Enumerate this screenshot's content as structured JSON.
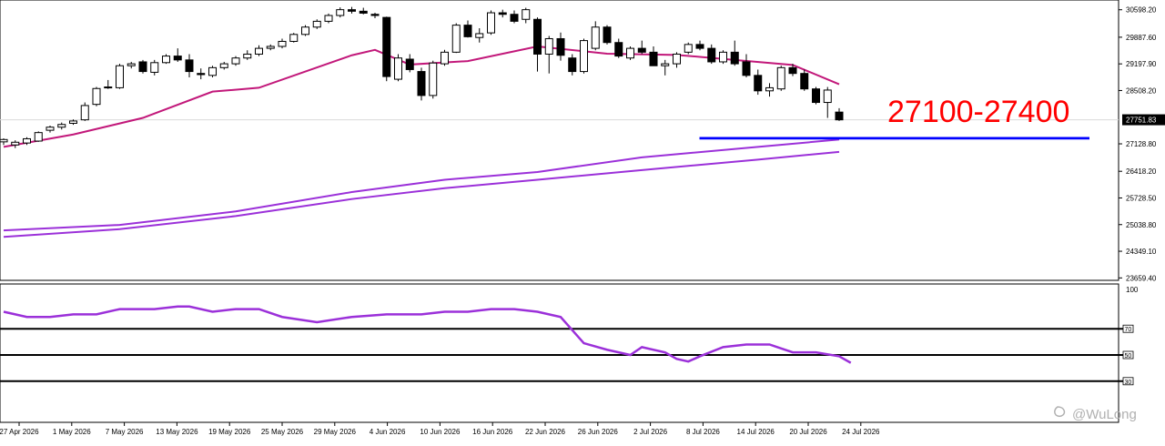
{
  "chart_data": [
    {
      "type": "candlestick",
      "title": "",
      "price_axis": {
        "ticks": [
          "30598.20",
          "29887.60",
          "29197.90",
          "28508.20",
          "27128.80",
          "26418.20",
          "25728.50",
          "25038.80",
          "24349.10",
          "23659.40"
        ],
        "range": [
          23620,
          30780
        ],
        "last_price_label": "27751.83"
      },
      "date_axis": {
        "ticks": [
          "27 Apr 2026",
          "1 May 2026",
          "7 May 2026",
          "13 May 2026",
          "19 May 2026",
          "25 May 2026",
          "29 May 2026",
          "4 Jun 2026",
          "10 Jun 2026",
          "16 Jun 2026",
          "22 Jun 2026",
          "26 Jun 2026",
          "2 Jul 2026",
          "8 Jul 2026",
          "14 Jul 2026",
          "20 Jul 2026",
          "24 Jul 2026"
        ]
      },
      "candles": [
        [
          27180,
          27270,
          27100,
          27240
        ],
        [
          27100,
          27220,
          27020,
          27170
        ],
        [
          27150,
          27300,
          27100,
          27260
        ],
        [
          27200,
          27450,
          27180,
          27420
        ],
        [
          27480,
          27600,
          27420,
          27560
        ],
        [
          27560,
          27680,
          27500,
          27630
        ],
        [
          27660,
          27760,
          27620,
          27720
        ],
        [
          27750,
          28200,
          27720,
          28120
        ],
        [
          28150,
          28600,
          28100,
          28560
        ],
        [
          28600,
          28780,
          28550,
          28580
        ],
        [
          28580,
          29200,
          28550,
          29150
        ],
        [
          29150,
          29250,
          29080,
          29200
        ],
        [
          29250,
          29300,
          28950,
          29000
        ],
        [
          28980,
          29300,
          28900,
          29230
        ],
        [
          29230,
          29450,
          29200,
          29400
        ],
        [
          29400,
          29600,
          29250,
          29300
        ],
        [
          29300,
          29450,
          28850,
          29000
        ],
        [
          28950,
          29080,
          28800,
          28920
        ],
        [
          28900,
          29150,
          28850,
          29100
        ],
        [
          29100,
          29250,
          29050,
          29200
        ],
        [
          29200,
          29400,
          29150,
          29350
        ],
        [
          29350,
          29550,
          29300,
          29450
        ],
        [
          29450,
          29680,
          29400,
          29600
        ],
        [
          29600,
          29700,
          29550,
          29650
        ],
        [
          29650,
          29850,
          29600,
          29780
        ],
        [
          29780,
          30000,
          29750,
          29960
        ],
        [
          29960,
          30200,
          29920,
          30150
        ],
        [
          30150,
          30350,
          30100,
          30300
        ],
        [
          30300,
          30500,
          30250,
          30450
        ],
        [
          30450,
          30660,
          30400,
          30600
        ],
        [
          30600,
          30670,
          30500,
          30560
        ],
        [
          30560,
          30650,
          30480,
          30510
        ],
        [
          30480,
          30520,
          30380,
          30450
        ],
        [
          30400,
          30420,
          28750,
          28870
        ],
        [
          28800,
          29450,
          28750,
          29350
        ],
        [
          29320,
          29450,
          28980,
          29050
        ],
        [
          29000,
          29100,
          28250,
          28380
        ],
        [
          28380,
          29280,
          28300,
          29220
        ],
        [
          29200,
          29560,
          29150,
          29500
        ],
        [
          29500,
          30250,
          29480,
          30200
        ],
        [
          30200,
          30320,
          29880,
          29900
        ],
        [
          29880,
          30120,
          29750,
          29980
        ],
        [
          30000,
          30580,
          29950,
          30520
        ],
        [
          30520,
          30600,
          30400,
          30480
        ],
        [
          30480,
          30580,
          30250,
          30300
        ],
        [
          30350,
          30650,
          30250,
          30600
        ],
        [
          30350,
          30400,
          29000,
          29450
        ],
        [
          29450,
          29920,
          28950,
          29850
        ],
        [
          29850,
          30010,
          29280,
          29420
        ],
        [
          29350,
          29450,
          28900,
          29000
        ],
        [
          29000,
          29850,
          28950,
          29800
        ],
        [
          29600,
          30300,
          29550,
          30150
        ],
        [
          30150,
          30200,
          29700,
          29750
        ],
        [
          29750,
          29850,
          29350,
          29400
        ],
        [
          29350,
          29650,
          29300,
          29600
        ],
        [
          29600,
          29800,
          29450,
          29500
        ],
        [
          29500,
          29650,
          29150,
          29150
        ],
        [
          29150,
          29300,
          28900,
          29200
        ],
        [
          29200,
          29500,
          29100,
          29450
        ],
        [
          29500,
          29750,
          29450,
          29700
        ],
        [
          29700,
          29800,
          29550,
          29600
        ],
        [
          29600,
          29700,
          29200,
          29250
        ],
        [
          29250,
          29550,
          29200,
          29500
        ],
        [
          29500,
          29800,
          29150,
          29200
        ],
        [
          29250,
          29450,
          28850,
          28900
        ],
        [
          28900,
          29050,
          28400,
          28500
        ],
        [
          28500,
          28700,
          28350,
          28580
        ],
        [
          28550,
          29150,
          28500,
          29100
        ],
        [
          29100,
          29200,
          28880,
          28950
        ],
        [
          28950,
          29050,
          28500,
          28550
        ],
        [
          28550,
          28600,
          28150,
          28200
        ],
        [
          28200,
          28600,
          27800,
          28520
        ],
        [
          27950,
          28050,
          27720,
          27750
        ]
      ],
      "indicator_lines": [
        {
          "color": "#c2187a",
          "label": "",
          "values": [
            [
              0,
              27050
            ],
            [
              6,
              27370
            ],
            [
              12,
              27800
            ],
            [
              18,
              28480
            ],
            [
              22,
              28580
            ],
            [
              30,
              29420
            ],
            [
              32,
              29560
            ],
            [
              35,
              29180
            ],
            [
              40,
              29270
            ],
            [
              46,
              29650
            ],
            [
              52,
              29460
            ],
            [
              58,
              29430
            ],
            [
              63,
              29300
            ],
            [
              68,
              29170
            ],
            [
              72,
              28670
            ]
          ]
        },
        {
          "color": "#9b30d9",
          "label": "",
          "values": [
            [
              0,
              24890
            ],
            [
              10,
              25030
            ],
            [
              20,
              25380
            ],
            [
              30,
              25880
            ],
            [
              38,
              26200
            ],
            [
              46,
              26400
            ],
            [
              55,
              26780
            ],
            [
              65,
              27050
            ],
            [
              72,
              27240
            ]
          ]
        },
        {
          "color": "#9b30d9",
          "label": "",
          "values": [
            [
              0,
              24720
            ],
            [
              10,
              24920
            ],
            [
              20,
              25260
            ],
            [
              30,
              25700
            ],
            [
              38,
              25980
            ],
            [
              46,
              26200
            ],
            [
              55,
              26450
            ],
            [
              65,
              26720
            ],
            [
              72,
              26920
            ]
          ]
        }
      ],
      "target_zone": {
        "label": "27100-27400",
        "low": 27100,
        "high": 27400,
        "color": "#0000ff",
        "start_index": 60
      }
    },
    {
      "type": "line",
      "title": "",
      "oscillator_axis": {
        "range": [
          0,
          100
        ],
        "max_label": "100",
        "levels": [
          70,
          50,
          30
        ]
      },
      "series": [
        {
          "color": "#9b30d9",
          "values": [
            [
              0,
              83
            ],
            [
              2,
              79
            ],
            [
              4,
              79
            ],
            [
              6,
              81
            ],
            [
              8,
              81
            ],
            [
              10,
              85
            ],
            [
              13,
              85
            ],
            [
              15,
              87
            ],
            [
              16,
              87
            ],
            [
              18,
              83
            ],
            [
              20,
              85
            ],
            [
              22,
              85
            ],
            [
              24,
              79
            ],
            [
              27,
              75
            ],
            [
              30,
              79
            ],
            [
              33,
              81
            ],
            [
              36,
              81
            ],
            [
              38,
              83
            ],
            [
              40,
              83
            ],
            [
              42,
              85
            ],
            [
              44,
              85
            ],
            [
              46,
              83
            ],
            [
              48,
              79
            ],
            [
              50,
              59
            ],
            [
              52,
              54
            ],
            [
              54,
              50
            ],
            [
              55,
              56
            ],
            [
              57,
              52
            ],
            [
              58,
              47
            ],
            [
              59,
              45
            ],
            [
              60,
              49
            ],
            [
              62,
              56
            ],
            [
              64,
              58
            ],
            [
              66,
              58
            ],
            [
              68,
              52
            ],
            [
              70,
              52
            ],
            [
              72,
              49
            ],
            [
              73,
              44
            ]
          ]
        }
      ]
    }
  ],
  "watermark": "@WuLong"
}
